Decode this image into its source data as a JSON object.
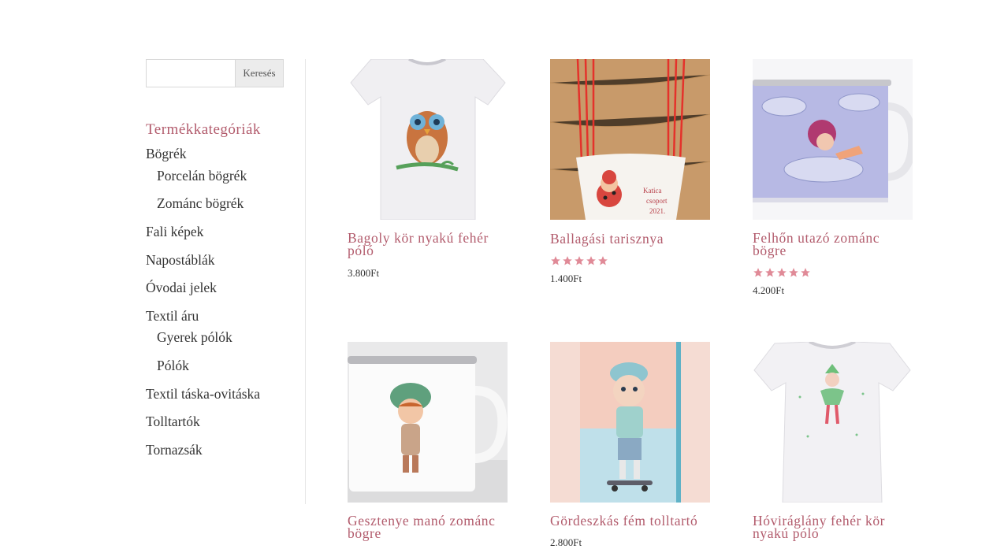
{
  "search": {
    "placeholder": "",
    "button_label": "Keresés"
  },
  "categories": {
    "title": "Termékkategóriák",
    "items": [
      {
        "label": "Bögrék"
      },
      {
        "label": "Porcelán bögrék"
      },
      {
        "label": "Zománc bögrék"
      },
      {
        "label": "Fali képek"
      },
      {
        "label": "Napostáblák"
      },
      {
        "label": "Óvodai jelek"
      },
      {
        "label": "Textil áru"
      },
      {
        "label": "Gyerek pólók"
      },
      {
        "label": "Pólók"
      },
      {
        "label": "Textil táska-ovitáska"
      },
      {
        "label": "Tolltartók"
      },
      {
        "label": "Tornazsák"
      }
    ]
  },
  "products": [
    {
      "title_line1": "Bagoly kör nyakú fehér",
      "title_line2": "póló",
      "price": "3.800Ft",
      "rating": null,
      "image": "owl-tshirt"
    },
    {
      "title_line1": "Ballagási tarisznya",
      "title_line2": "",
      "price": "1.400Ft",
      "rating": 5,
      "image": "ladybug-bag",
      "image_text": [
        "Katica",
        "csoport",
        "2021."
      ]
    },
    {
      "title_line1": "Felhőn utazó zománc",
      "title_line2": "bögre",
      "price": "4.200Ft",
      "rating": 5,
      "image": "cloud-girl-mug"
    },
    {
      "title_line1": "Gesztenye manó zománc",
      "title_line2": "bögre",
      "price": "",
      "rating": null,
      "image": "chestnut-elf-mug"
    },
    {
      "title_line1": "Gördeszkás fém tolltartó",
      "title_line2": "",
      "price": "2.800Ft",
      "rating": null,
      "image": "skateboard-pencilcase"
    },
    {
      "title_line1": "Hóviráglány fehér kör",
      "title_line2": "nyakú póló",
      "price": "",
      "rating": null,
      "image": "snowdrop-girl-tshirt"
    }
  ],
  "colors": {
    "accent": "#b25b6c",
    "star": "#e08a97"
  }
}
